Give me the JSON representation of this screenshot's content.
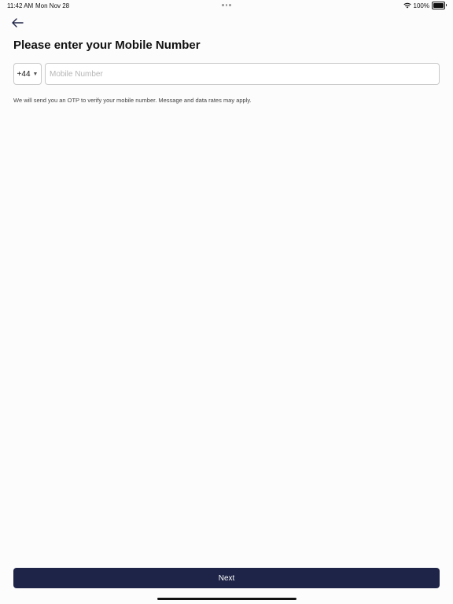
{
  "status_bar": {
    "time": "11:42 AM",
    "date": "Mon Nov 28",
    "battery": "100%",
    "battery_level": 1.0
  },
  "header": {
    "back_icon": "arrow-left-icon"
  },
  "page": {
    "title": "Please enter your Mobile Number"
  },
  "phone": {
    "country_code": "+44",
    "placeholder": "Mobile Number",
    "value": ""
  },
  "note": "We will send you an OTP to verify your mobile number. Message and data rates may apply.",
  "actions": {
    "next_label": "Next"
  },
  "colors": {
    "primary": "#1e2447",
    "border": "#c9c9c9",
    "background": "#fcfcfc"
  }
}
